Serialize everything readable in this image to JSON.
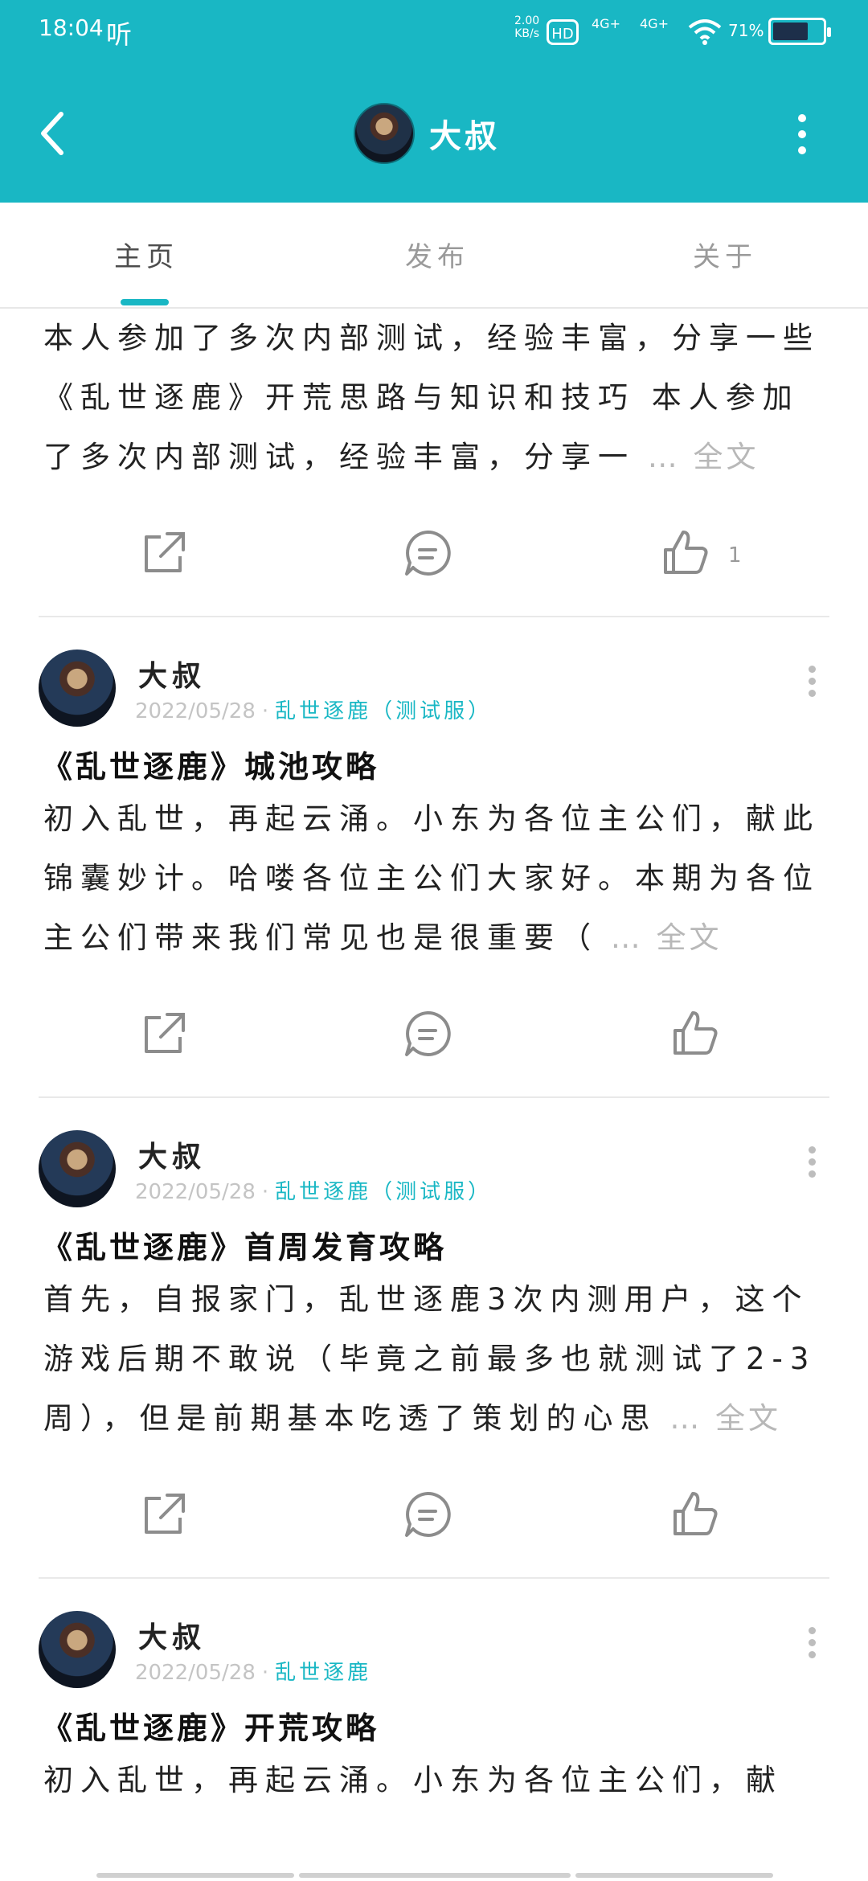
{
  "status_bar": {
    "time": "18:04",
    "extra": "听",
    "net_speed": "2.00\nKB/s",
    "hd": "HD",
    "sig1": "4G+",
    "sig2": "4G+",
    "battery_pct": "71%",
    "battery_level": 0.71
  },
  "header": {
    "title": "大叔"
  },
  "tabs": [
    {
      "label": "主页",
      "active": true
    },
    {
      "label": "发布",
      "active": false
    },
    {
      "label": "关于",
      "active": false
    }
  ],
  "top_post": {
    "text": "本人参加了多次内部测试，经验丰富，分享一些《乱世逐鹿》开荒思路与知识和技巧 本人参加了多次内部测试，经验丰富，分享一",
    "ellipsis": "…",
    "full_label": "全文",
    "like_count": "1"
  },
  "posts": [
    {
      "author": "大叔",
      "date": "2022/05/28",
      "game": "乱世逐鹿（测试服）",
      "title": "《乱世逐鹿》城池攻略",
      "text": "初入乱世，再起云涌。小东为各位主公们，献此锦囊妙计。哈喽各位主公们大家好。本期为各位主公们带来我们常见也是很重要（",
      "ellipsis": "…",
      "full_label": "全文"
    },
    {
      "author": "大叔",
      "date": "2022/05/28",
      "game": "乱世逐鹿（测试服）",
      "title": "《乱世逐鹿》首周发育攻略",
      "text": "首先，自报家门，乱世逐鹿3次内测用户，这个游戏后期不敢说（毕竟之前最多也就测试了2-3周），但是前期基本吃透了策划的心思",
      "ellipsis": "…",
      "full_label": "全文"
    },
    {
      "author": "大叔",
      "date": "2022/05/28",
      "game": "乱世逐鹿",
      "title": "《乱世逐鹿》开荒攻略",
      "text": "初入乱世，再起云涌。小东为各位主公们，献"
    }
  ],
  "colors": {
    "accent": "#19b7c4",
    "muted": "#c4c4c4"
  },
  "icons": {
    "share": "share-icon",
    "comment": "comment-icon",
    "like": "like-icon"
  }
}
